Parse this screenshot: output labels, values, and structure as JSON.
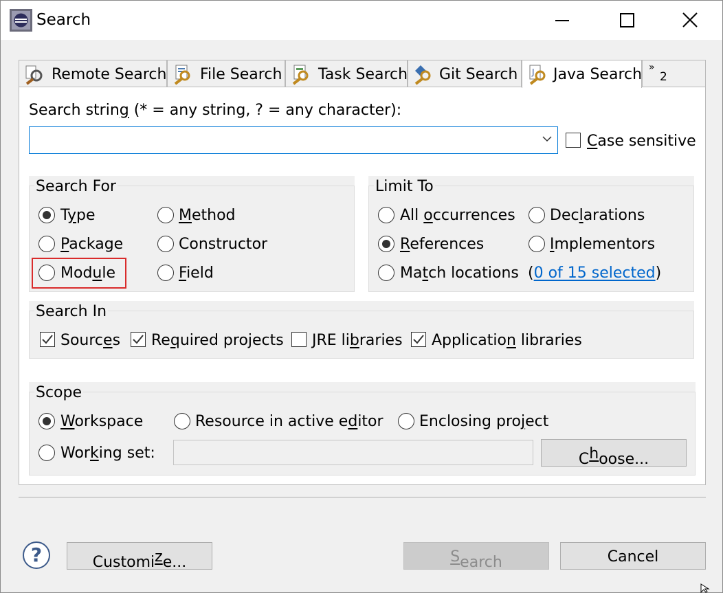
{
  "window": {
    "title": "Search"
  },
  "tabs": [
    {
      "label": "Remote Search",
      "icon": "remote-search-icon"
    },
    {
      "label": "File Search",
      "icon": "file-search-icon"
    },
    {
      "label": "Task Search",
      "icon": "task-search-icon"
    },
    {
      "label": "Git Search",
      "icon": "git-search-icon"
    },
    {
      "label": "Java Search",
      "icon": "java-search-icon",
      "active": true
    }
  ],
  "tab_overflow": {
    "chevron": "»",
    "count": "2"
  },
  "search_string": {
    "label_pre": "Search strin",
    "label_u": "g",
    "label_post": " (* = any string, ? = any character):",
    "value": ""
  },
  "case_sensitive": {
    "u": "C",
    "rest": "ase sensitive",
    "checked": false
  },
  "search_for": {
    "title": "Search For",
    "type": {
      "pre": "T",
      "u": "y",
      "post": "pe",
      "selected": true
    },
    "method": {
      "pre": "",
      "u": "M",
      "post": "ethod"
    },
    "package": {
      "pre": "",
      "u": "P",
      "post": "ackage"
    },
    "constructor": {
      "pre": "Constructor",
      "u": "",
      "post": ""
    },
    "module": {
      "pre": "Mod",
      "u": "u",
      "post": "le"
    },
    "field": {
      "pre": "",
      "u": "F",
      "post": "ield"
    }
  },
  "limit_to": {
    "title": "Limit To",
    "all": {
      "pre": "All ",
      "u": "o",
      "post": "ccurrences"
    },
    "declarations": {
      "pre": "Dec",
      "u": "l",
      "post": "arations"
    },
    "references": {
      "pre": "",
      "u": "R",
      "post": "eferences",
      "selected": true
    },
    "implementors": {
      "pre": "",
      "u": "I",
      "post": "mplementors"
    },
    "match": {
      "pre": "Ma",
      "u": "t",
      "post": "ch locations"
    },
    "selected_open": "(",
    "selected_link": "0 of 15 selected",
    "selected_close": ")"
  },
  "search_in": {
    "title": "Search In",
    "sources": {
      "pre": "Sourc",
      "u": "e",
      "post": "s",
      "checked": true
    },
    "required": {
      "pre": "Re",
      "u": "q",
      "post": "uired projects",
      "checked": true
    },
    "jre": {
      "pre": "JRE li",
      "u": "b",
      "post": "raries",
      "checked": false
    },
    "application": {
      "pre": "Applicatio",
      "u": "n",
      "post": " libraries",
      "checked": true
    }
  },
  "scope": {
    "title": "Scope",
    "workspace": {
      "pre": "",
      "u": "W",
      "post": "orkspace",
      "selected": true
    },
    "resource": {
      "pre": "Resource in active e",
      "u": "d",
      "post": "itor"
    },
    "enclosing": {
      "pre": "Enclosing pro",
      "u": "j",
      "post": "ect"
    },
    "working_set": {
      "pre": "Wor",
      "u": "k",
      "post": "ing set:"
    },
    "working_set_value": "",
    "choose": {
      "pre": "C",
      "u": "h",
      "post": "oose..."
    }
  },
  "buttons": {
    "customize": {
      "pre": "Customi",
      "u": "z",
      "post": "e..."
    },
    "search": {
      "pre": "",
      "u": "S",
      "post": "earch"
    },
    "cancel": "Cancel"
  },
  "colors": {
    "accent": "#0078d7",
    "highlight": "#d92b2b",
    "link": "#0066cc"
  }
}
